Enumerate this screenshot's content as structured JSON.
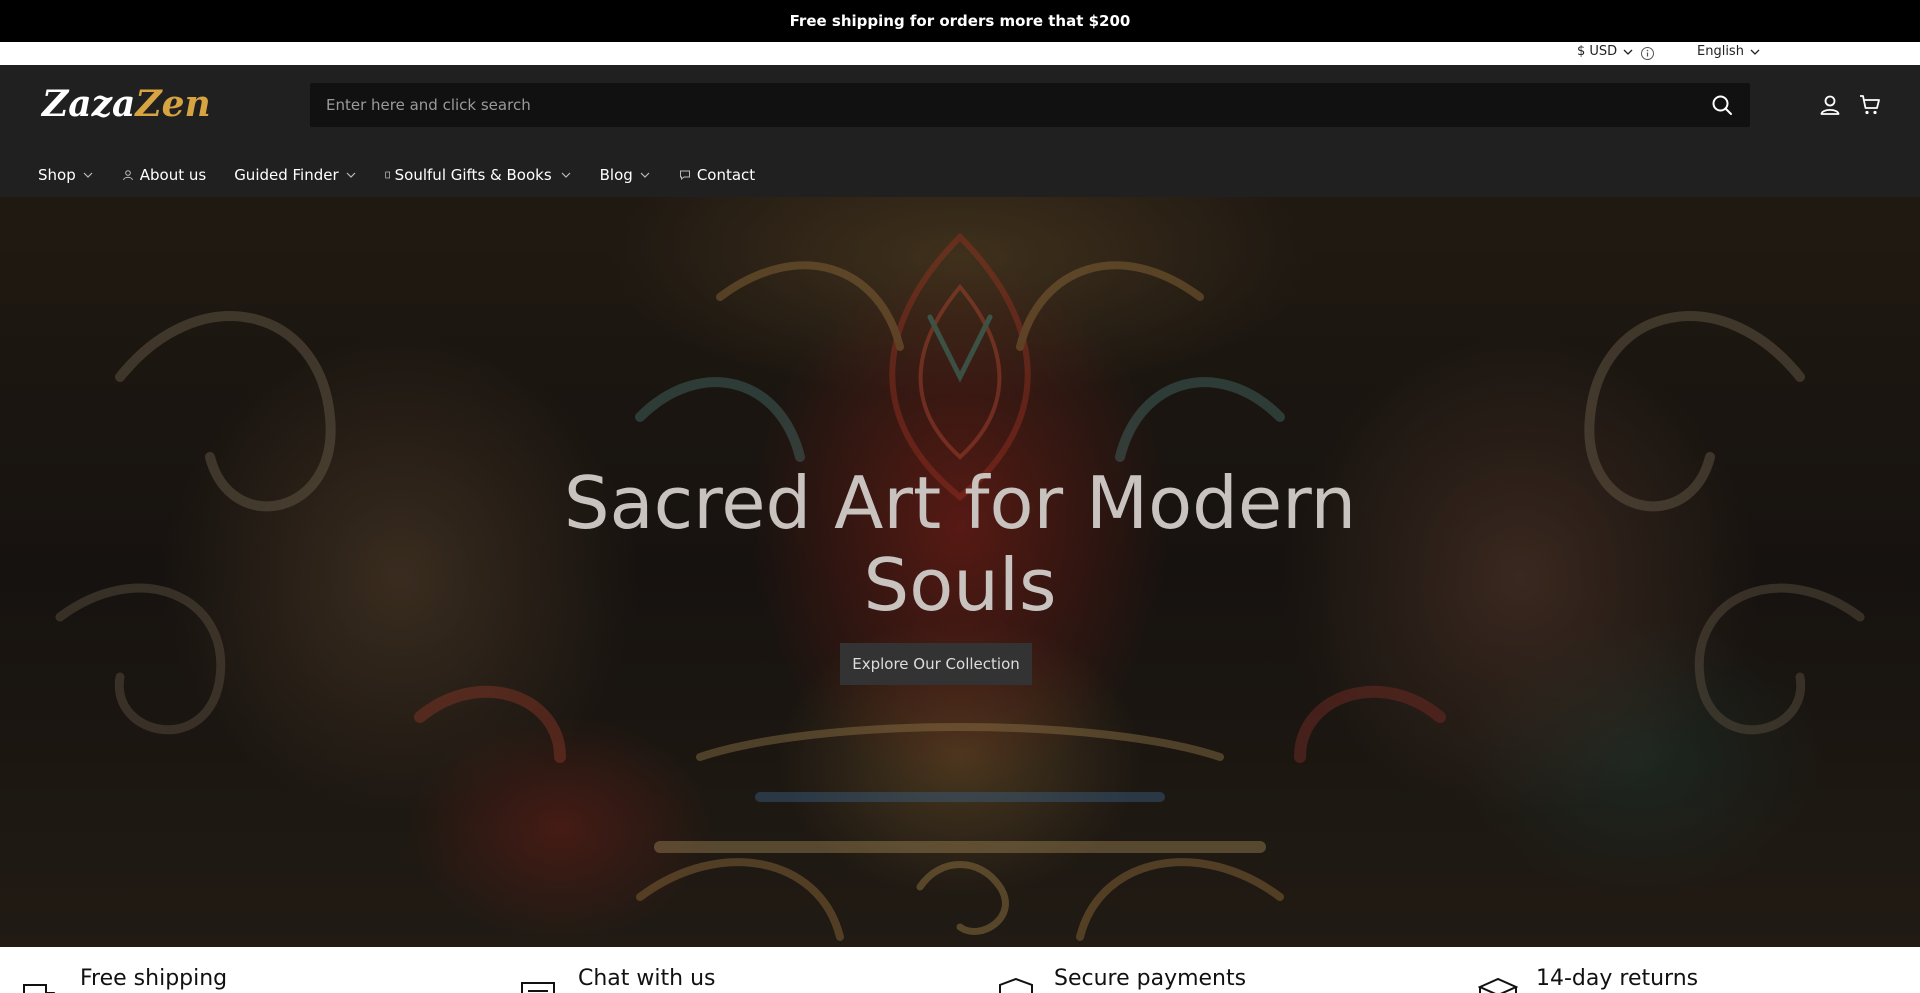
{
  "announcement": {
    "text": "Free shipping for orders more that $200"
  },
  "topbar": {
    "currency": "$ USD",
    "language": "English"
  },
  "header": {
    "logo": {
      "part1": "Zaza",
      "part2": "Zen"
    },
    "search": {
      "placeholder": "Enter here and click search"
    }
  },
  "nav": {
    "items": [
      {
        "label": "Shop"
      },
      {
        "label": "About us"
      },
      {
        "label": "Guided Finder"
      },
      {
        "label": "Soulful Gifts & Books"
      },
      {
        "label": "Blog"
      },
      {
        "label": "Contact"
      }
    ]
  },
  "hero": {
    "title_line1": "Sacred Art for Modern",
    "title_line2": "Souls",
    "button_label": "Explore Our Collection"
  },
  "features": [
    {
      "label": "Free shipping",
      "icon": "truck-icon"
    },
    {
      "label": "Chat with us",
      "icon": "chat-icon"
    },
    {
      "label": "Secure payments",
      "icon": "shield-icon"
    },
    {
      "label": "14-day returns",
      "icon": "box-icon"
    }
  ],
  "colors": {
    "header_bg": "#202020",
    "announcement_bg": "#000000",
    "logo_accent": "#d8a441"
  }
}
